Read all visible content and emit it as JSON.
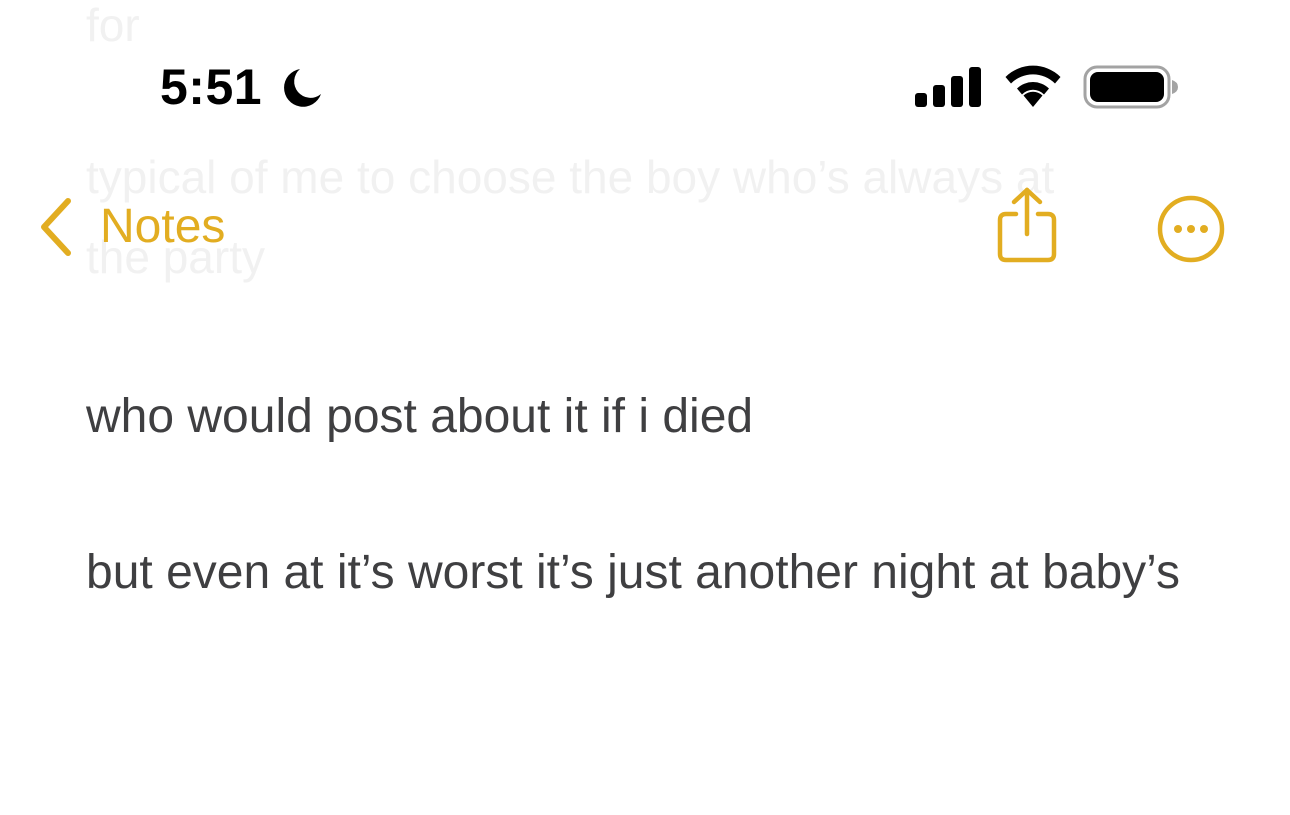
{
  "background_note": {
    "lines": [
      "for",
      "typical of me to choose the boy who’s always at",
      "the party"
    ]
  },
  "status_bar": {
    "time": "5:51",
    "focus_icon": "moon-icon",
    "signal_icon": "cellular-signal-icon",
    "wifi_icon": "wifi-icon",
    "battery_icon": "battery-icon"
  },
  "nav_bar": {
    "back_label": "Notes",
    "back_icon": "chevron-left-icon",
    "share_icon": "share-icon",
    "more_icon": "ellipsis-circle-icon",
    "accent_color": "#E2AD21"
  },
  "note": {
    "paragraphs": [
      "who would post about it if i died",
      "but even at it’s worst it’s just another night at baby’s"
    ],
    "text_color": "#3F3F41"
  }
}
